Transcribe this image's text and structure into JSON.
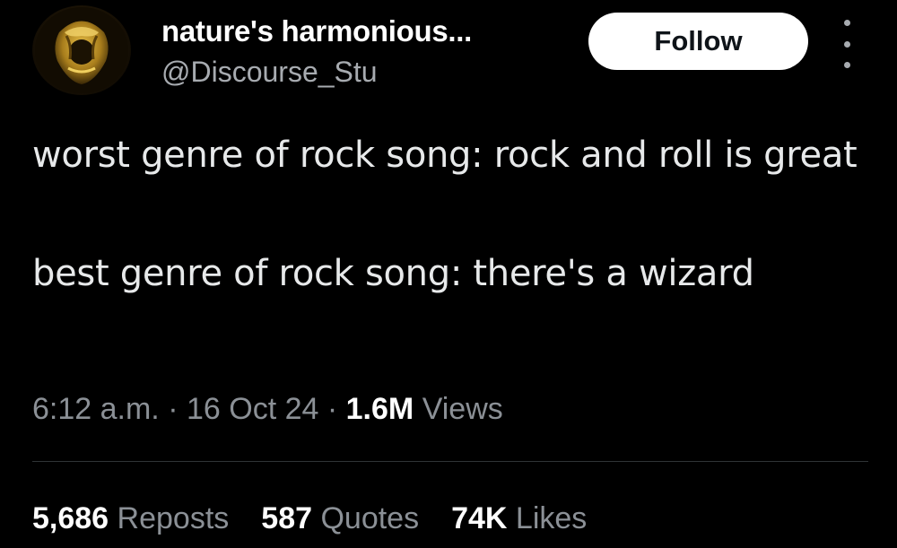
{
  "author": {
    "display_name": "nature's harmonious...",
    "handle": "@Discourse_Stu"
  },
  "actions": {
    "follow_label": "Follow"
  },
  "tweet": {
    "line_1": "worst genre of rock song: rock and roll is great",
    "line_2": "best genre of rock song: there's a wizard"
  },
  "meta": {
    "time": "6:12 a.m.",
    "separator": "·",
    "date": "16 Oct 24",
    "views_count": "1.6M",
    "views_label": "Views"
  },
  "stats": {
    "reposts_count": "5,686",
    "reposts_label": "Reposts",
    "quotes_count": "587",
    "quotes_label": "Quotes",
    "likes_count": "74K",
    "likes_label": "Likes"
  },
  "colors": {
    "background": "#000000",
    "primary_text": "#e7e9ea",
    "secondary_text": "#8b9096",
    "follow_button_bg": "#ffffff",
    "avatar_accent": "#c9a227"
  },
  "icons": {
    "more": "more-vertical-icon"
  }
}
